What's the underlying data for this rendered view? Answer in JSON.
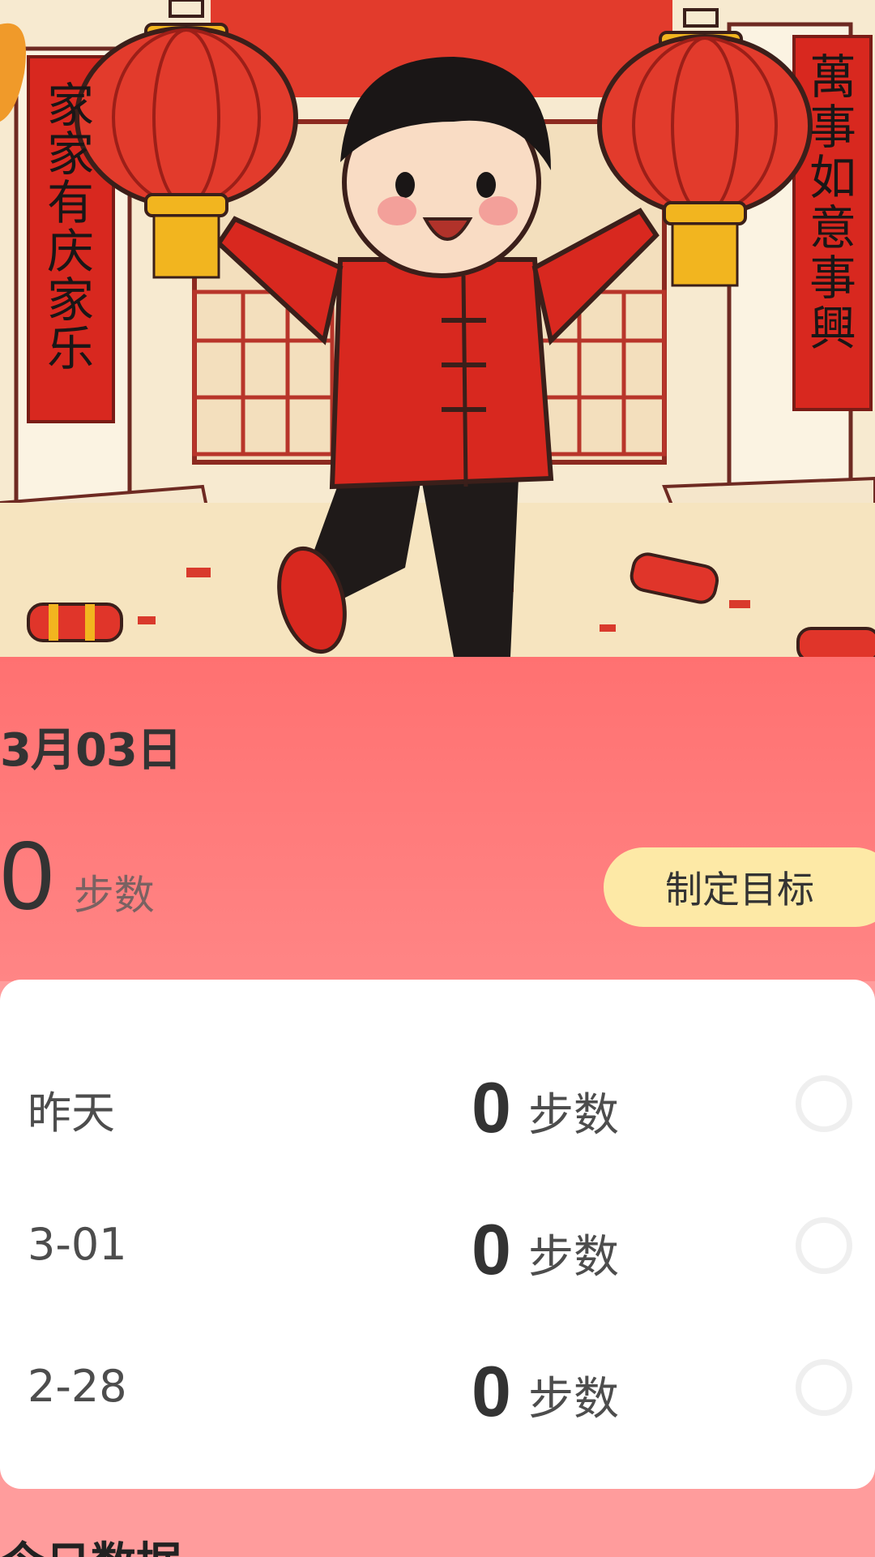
{
  "banner": {
    "illustration": "new-year-boy-with-lanterns",
    "couplet_left": "家家有庆家乐",
    "couplet_right": "萬事如意事興",
    "colors": {
      "red": "#e02f24",
      "gold": "#f2b51f",
      "cream": "#f7ead0",
      "outline": "#3b1f1a"
    }
  },
  "summary": {
    "date": "3月03日",
    "today_steps": "0",
    "unit": "步数",
    "goal_button": "制定目标",
    "background": "#ff7373"
  },
  "history": [
    {
      "day": "昨天",
      "steps": "0",
      "unit": "步数"
    },
    {
      "day": "3-01",
      "steps": "0",
      "unit": "步数"
    },
    {
      "day": "2-28",
      "steps": "0",
      "unit": "步数"
    }
  ],
  "section": {
    "title": "今日数据"
  }
}
